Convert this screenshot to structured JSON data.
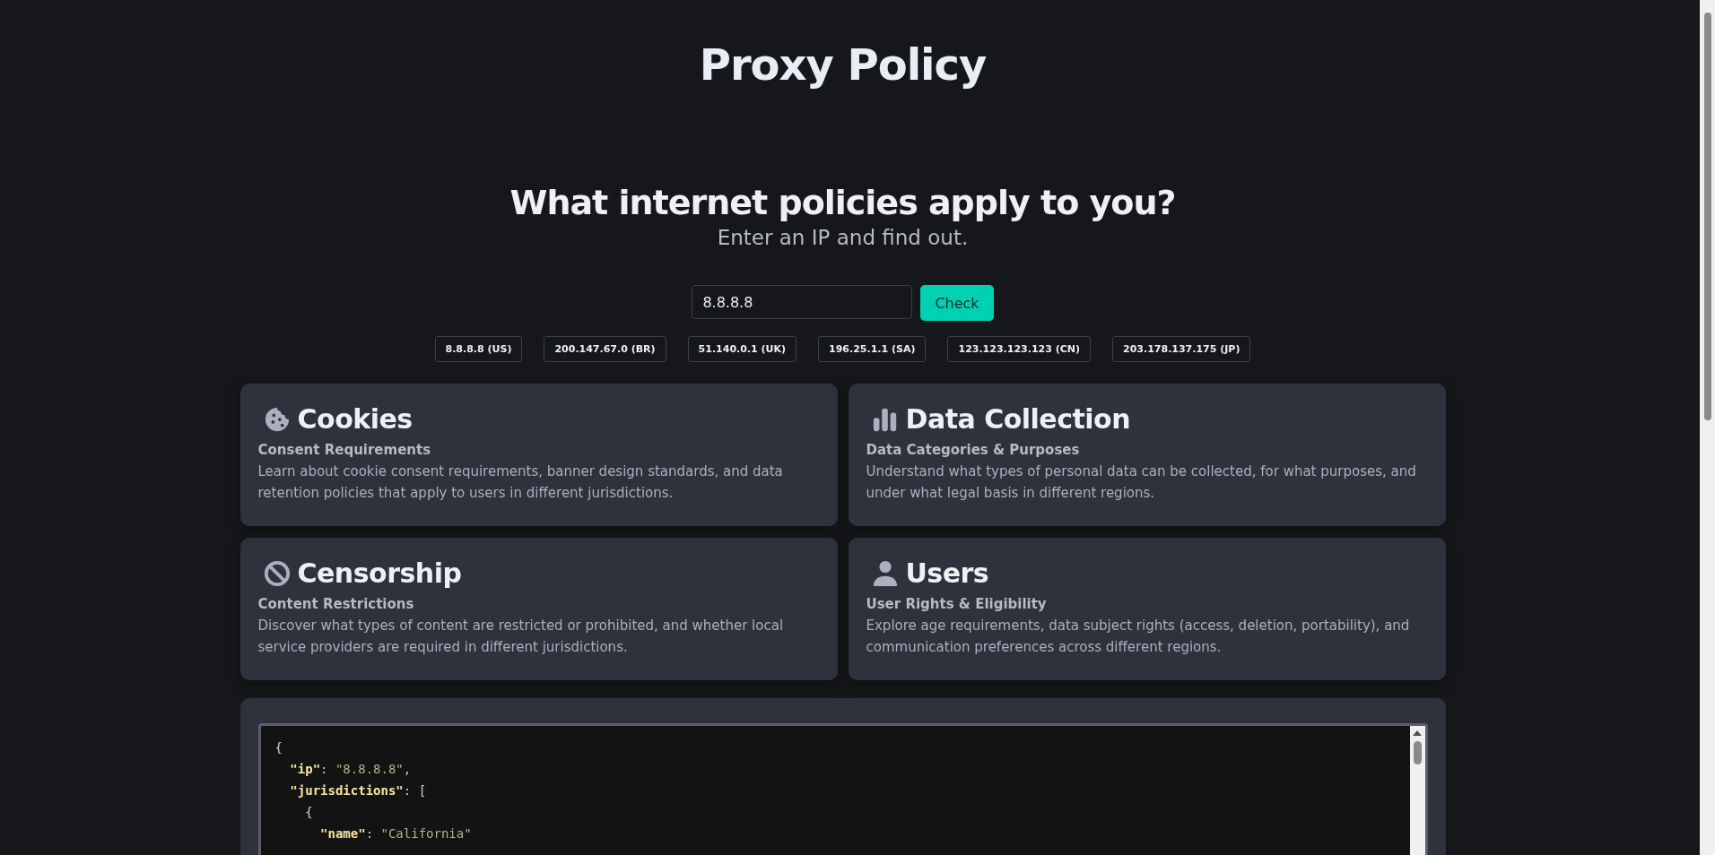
{
  "brand": {
    "title": "Proxy Policy"
  },
  "hero": {
    "heading": "What internet policies apply to you?",
    "subheading": "Enter an IP and find out."
  },
  "lookup": {
    "value": "8.8.8.8",
    "button": "Check"
  },
  "examples": [
    "8.8.8.8 (US)",
    "200.147.67.0 (BR)",
    "51.140.0.1 (UK)",
    "196.25.1.1 (SA)",
    "123.123.123.123 (CN)",
    "203.178.137.175 (JP)"
  ],
  "cards": [
    {
      "kind": "cookie",
      "title": "Cookies",
      "subtitle": "Consent Requirements",
      "description": "Learn about cookie consent requirements, banner design standards, and data retention policies that apply to users in different jurisdictions."
    },
    {
      "kind": "chart",
      "title": "Data Collection",
      "subtitle": "Data Categories & Purposes",
      "description": "Understand what types of personal data can be collected, for what purposes, and under what legal basis in different regions."
    },
    {
      "kind": "ban",
      "title": "Censorship",
      "subtitle": "Content Restrictions",
      "description": "Discover what types of content are restricted or prohibited, and whether local service providers are required in different jurisdictions."
    },
    {
      "kind": "user",
      "title": "Users",
      "subtitle": "User Rights & Eligibility",
      "description": "Explore age requirements, data subject rights (access, deletion, portability), and communication preferences across different regions."
    }
  ],
  "result": {
    "lines": [
      [
        {
          "kind": "punct",
          "text": "{"
        }
      ],
      [
        {
          "kind": "key",
          "text": "  \"ip\""
        },
        {
          "kind": "punct",
          "text": ": "
        },
        {
          "kind": "string",
          "text": "\"8.8.8.8\""
        },
        {
          "kind": "punct",
          "text": ","
        }
      ],
      [
        {
          "kind": "key",
          "text": "  \"jurisdictions\""
        },
        {
          "kind": "punct",
          "text": ": ["
        }
      ],
      [
        {
          "kind": "punct",
          "text": "    {"
        }
      ],
      [
        {
          "kind": "key",
          "text": "      \"name\""
        },
        {
          "kind": "punct",
          "text": ": "
        },
        {
          "kind": "string",
          "text": "\"California\""
        }
      ]
    ]
  }
}
